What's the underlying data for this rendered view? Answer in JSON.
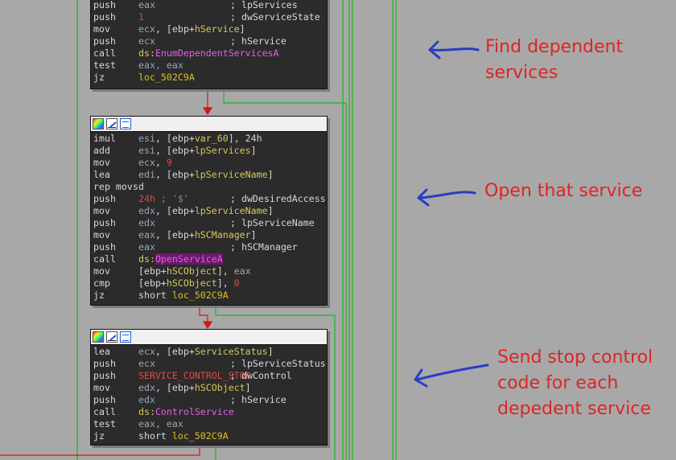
{
  "blocks": [
    {
      "lines": [
        {
          "mn": "push",
          "op": [
            {
              "t": "eax",
              "c": "t-reg"
            }
          ],
          "cm": "; lpServices"
        },
        {
          "mn": "push",
          "op": [
            {
              "t": "1",
              "c": "t-num"
            }
          ],
          "cm": "; dwServiceState"
        },
        {
          "mn": "mov",
          "op": [
            {
              "t": "ecx",
              "c": "t-reg"
            },
            {
              "t": ", [ebp+",
              "c": "t-plain"
            },
            {
              "t": "hService",
              "c": "t-var"
            },
            {
              "t": "]",
              "c": "t-plain"
            }
          ],
          "cm": ""
        },
        {
          "mn": "push",
          "op": [
            {
              "t": "ecx",
              "c": "t-reg"
            }
          ],
          "cm": "; hService"
        },
        {
          "mn": "call",
          "op": [
            {
              "t": "ds:",
              "c": "t-var"
            },
            {
              "t": "EnumDependentServicesA",
              "c": "t-api"
            }
          ],
          "cm": ""
        },
        {
          "mn": "test",
          "op": [
            {
              "t": "eax, eax",
              "c": "t-reg"
            }
          ],
          "cm": ""
        },
        {
          "mn": "jz",
          "op": [
            {
              "t": "loc_502C9A",
              "c": "t-loc"
            }
          ],
          "cm": ""
        }
      ]
    },
    {
      "lines": [
        {
          "mn": "imul",
          "op": [
            {
              "t": "esi",
              "c": "t-reg"
            },
            {
              "t": ", [ebp+",
              "c": "t-plain"
            },
            {
              "t": "var_60",
              "c": "t-var"
            },
            {
              "t": "], 24h",
              "c": "t-plain"
            }
          ],
          "cm": ""
        },
        {
          "mn": "add",
          "op": [
            {
              "t": "esi",
              "c": "t-reg"
            },
            {
              "t": ", [ebp+",
              "c": "t-plain"
            },
            {
              "t": "lpServices",
              "c": "t-var"
            },
            {
              "t": "]",
              "c": "t-plain"
            }
          ],
          "cm": ""
        },
        {
          "mn": "mov",
          "op": [
            {
              "t": "ecx",
              "c": "t-reg"
            },
            {
              "t": ", ",
              "c": "t-plain"
            },
            {
              "t": "9",
              "c": "t-num"
            }
          ],
          "cm": ""
        },
        {
          "mn": "lea",
          "op": [
            {
              "t": "edi",
              "c": "t-reg"
            },
            {
              "t": ", [ebp+",
              "c": "t-plain"
            },
            {
              "t": "lpServiceName",
              "c": "t-var"
            },
            {
              "t": "]",
              "c": "t-plain"
            }
          ],
          "cm": ""
        },
        {
          "mn": "rep movsd",
          "op": [],
          "cm": ""
        },
        {
          "mn": "push",
          "op": [
            {
              "t": "24h",
              "c": "t-num"
            },
            {
              "t": " ; '$'",
              "c": "t-dim"
            }
          ],
          "cm": "; dwDesiredAccess"
        },
        {
          "mn": "mov",
          "op": [
            {
              "t": "edx",
              "c": "t-reg"
            },
            {
              "t": ", [ebp+",
              "c": "t-plain"
            },
            {
              "t": "lpServiceName",
              "c": "t-var"
            },
            {
              "t": "]",
              "c": "t-plain"
            }
          ],
          "cm": ""
        },
        {
          "mn": "push",
          "op": [
            {
              "t": "edx",
              "c": "t-reg"
            }
          ],
          "cm": "; lpServiceName"
        },
        {
          "mn": "mov",
          "op": [
            {
              "t": "eax",
              "c": "t-reg"
            },
            {
              "t": ", [ebp+",
              "c": "t-plain"
            },
            {
              "t": "hSCManager",
              "c": "t-var"
            },
            {
              "t": "]",
              "c": "t-plain"
            }
          ],
          "cm": ""
        },
        {
          "mn": "push",
          "op": [
            {
              "t": "eax",
              "c": "t-reg"
            }
          ],
          "cm": "; hSCManager"
        },
        {
          "mn": "call",
          "op": [
            {
              "t": "ds:",
              "c": "t-var"
            },
            {
              "t": "OpenServiceA",
              "c": "t-api t-hl"
            }
          ],
          "cm": ""
        },
        {
          "mn": "mov",
          "op": [
            {
              "t": "[ebp+",
              "c": "t-plain"
            },
            {
              "t": "hSCObject",
              "c": "t-var"
            },
            {
              "t": "], ",
              "c": "t-plain"
            },
            {
              "t": "eax",
              "c": "t-reg"
            }
          ],
          "cm": ""
        },
        {
          "mn": "cmp",
          "op": [
            {
              "t": "[ebp+",
              "c": "t-plain"
            },
            {
              "t": "hSCObject",
              "c": "t-var"
            },
            {
              "t": "], ",
              "c": "t-plain"
            },
            {
              "t": "0",
              "c": "t-num"
            }
          ],
          "cm": ""
        },
        {
          "mn": "jz",
          "op": [
            {
              "t": "short ",
              "c": "t-plain"
            },
            {
              "t": "loc_502C9A",
              "c": "t-loc"
            }
          ],
          "cm": ""
        }
      ]
    },
    {
      "lines": [
        {
          "mn": "lea",
          "op": [
            {
              "t": "ecx",
              "c": "t-reg"
            },
            {
              "t": ", [ebp+",
              "c": "t-plain"
            },
            {
              "t": "ServiceStatus",
              "c": "t-var"
            },
            {
              "t": "]",
              "c": "t-plain"
            }
          ],
          "cm": ""
        },
        {
          "mn": "push",
          "op": [
            {
              "t": "ecx",
              "c": "t-reg"
            }
          ],
          "cm": "; lpServiceStatus"
        },
        {
          "mn": "push",
          "op": [
            {
              "t": "SERVICE_CONTROL_STOP",
              "c": "t-num"
            }
          ],
          "cm": "; dwControl"
        },
        {
          "mn": "mov",
          "op": [
            {
              "t": "edx",
              "c": "t-reg"
            },
            {
              "t": ", [ebp+",
              "c": "t-plain"
            },
            {
              "t": "hSCObject",
              "c": "t-var"
            },
            {
              "t": "]",
              "c": "t-plain"
            }
          ],
          "cm": ""
        },
        {
          "mn": "push",
          "op": [
            {
              "t": "edx",
              "c": "t-reg"
            }
          ],
          "cm": "; hService"
        },
        {
          "mn": "call",
          "op": [
            {
              "t": "ds:",
              "c": "t-var"
            },
            {
              "t": "ControlService",
              "c": "t-api"
            }
          ],
          "cm": ""
        },
        {
          "mn": "test",
          "op": [
            {
              "t": "eax, eax",
              "c": "t-reg"
            }
          ],
          "cm": ""
        },
        {
          "mn": "jz",
          "op": [
            {
              "t": "short ",
              "c": "t-plain"
            },
            {
              "t": "loc_502C9A",
              "c": "t-loc"
            }
          ],
          "cm": ""
        }
      ]
    }
  ],
  "annotations": {
    "find": "Find dependent\nservices",
    "open": "Open that service",
    "stop": "Send stop control\ncode for each\ndepedent service"
  },
  "colors": {
    "background": "#a8a8a8",
    "edge_green": "#1db51d",
    "edge_red": "#d01818",
    "annotation_red": "#e02424",
    "arrow_blue": "#2a3cc8"
  }
}
